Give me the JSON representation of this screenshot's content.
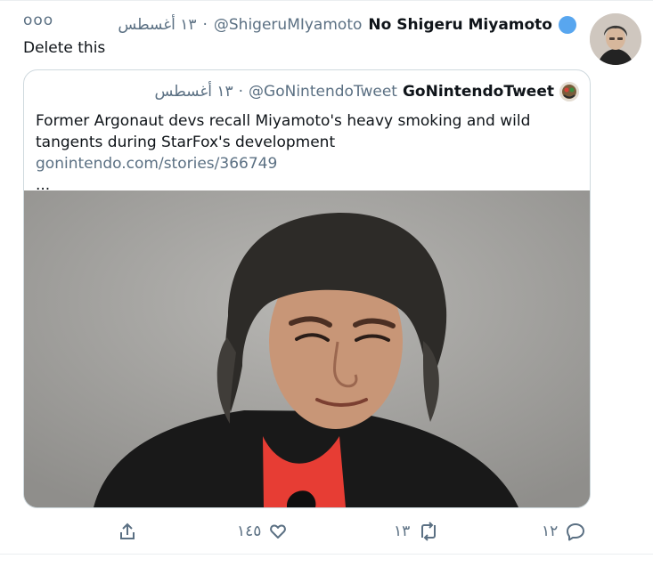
{
  "tweet": {
    "display_name": "No Shigeru Miyamoto",
    "handle": "@ShigeruMIyamoto",
    "separator": "·",
    "date": "١٣ أغسطس",
    "text": "Delete this",
    "more_glyph": "ooo"
  },
  "quote": {
    "display_name": "GoNintendoTweet",
    "handle": "@GoNintendoTweet",
    "separator": "·",
    "date": "١٣ أغسطس",
    "text": "Former Argonaut devs recall Miyamoto's heavy smoking and wild tangents during StarFox's development",
    "link": "gonintendo.com/stories/366749",
    "ellipsis": "..."
  },
  "actions": {
    "share": "",
    "likes": "١٤٥",
    "retweets": "١٣",
    "replies": "١٢"
  },
  "colors": {
    "accent": "#1da1f2",
    "muted": "#5b7083",
    "verified": "#58a6ef",
    "shirt": "#e33f36"
  }
}
